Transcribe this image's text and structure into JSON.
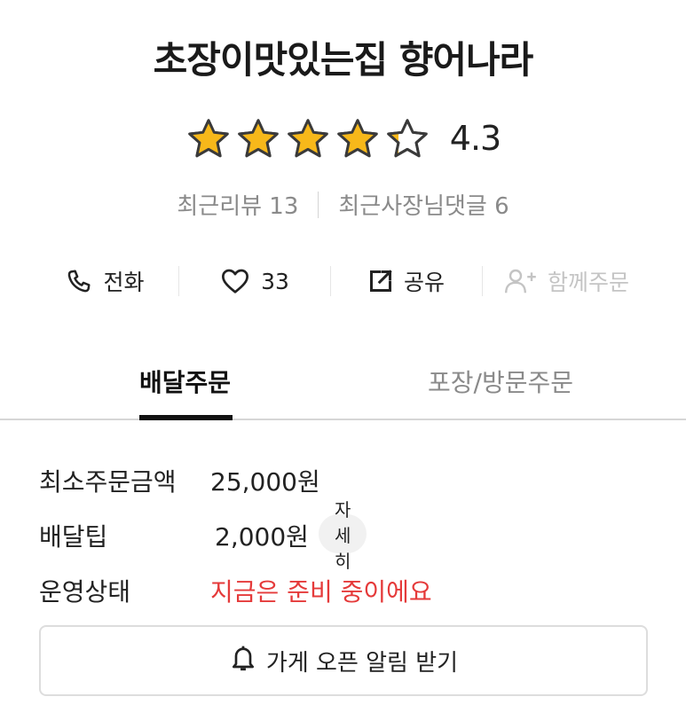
{
  "store": {
    "name": "초장이맛있는집 향어나라",
    "rating": 4.3,
    "rating_text": "4.3",
    "star_color": "#f7b81a",
    "recent_reviews": "최근리뷰 13",
    "owner_replies": "최근사장님댓글 6"
  },
  "actions": {
    "call": {
      "label": "전화",
      "icon": "phone-icon"
    },
    "like": {
      "label": "33",
      "icon": "heart-icon"
    },
    "share": {
      "label": "공유",
      "icon": "share-icon"
    },
    "group_order": {
      "label": "함께주문",
      "icon": "add-person-icon",
      "disabled": true
    }
  },
  "tabs": {
    "delivery": "배달주문",
    "pickup": "포장/방문주문",
    "active": "delivery"
  },
  "info": {
    "min_order_label": "최소주문금액",
    "min_order_value": "25,000원",
    "delivery_tip_label": "배달팁",
    "delivery_tip_value": "2,000원",
    "detail_button": "자세히",
    "status_label": "운영상태",
    "status_value": "지금은 준비 중이에요",
    "status_color": "#e53a3a"
  },
  "notify_button": {
    "label": "가게 오픈 알림 받기",
    "icon": "bell-icon"
  }
}
